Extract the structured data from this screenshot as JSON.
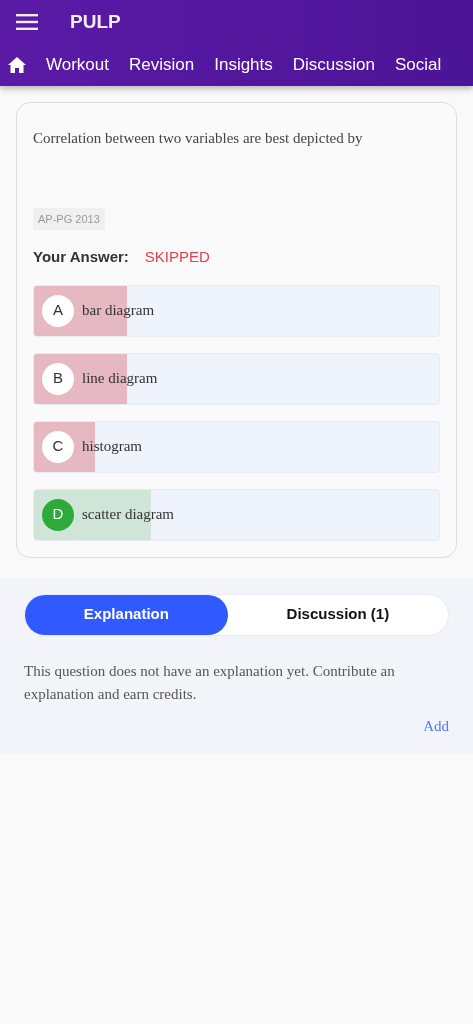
{
  "app_bar": {
    "title": "PULP"
  },
  "nav_tabs": [
    {
      "label": "Workout",
      "selected": false
    },
    {
      "label": "Revision",
      "selected": false
    },
    {
      "label": "Insights",
      "selected": false
    },
    {
      "label": "Discussion",
      "selected": false
    },
    {
      "label": "Social",
      "selected": false
    }
  ],
  "question": {
    "text": "Correlation between two variables are best depicted by",
    "tag": "AP-PG 2013",
    "answer_label": "Your Answer:",
    "answer_value": "SKIPPED"
  },
  "options": [
    {
      "letter": "A",
      "text": "bar diagram",
      "correct": false,
      "level": 0.23
    },
    {
      "letter": "B",
      "text": "line diagram",
      "correct": false,
      "level": 0.23
    },
    {
      "letter": "C",
      "text": "histogram",
      "correct": false,
      "level": 0.15
    },
    {
      "letter": "D",
      "text": "scatter diagram",
      "correct": true,
      "level": 0.29
    }
  ],
  "tabs": [
    {
      "label": "Explanation",
      "selected": true
    },
    {
      "label": "Discussion (1)",
      "selected": false
    }
  ],
  "explanation": {
    "text": "This question does not have an explanation yet. Contribute an explanation and earn credits.",
    "link": "Add"
  }
}
